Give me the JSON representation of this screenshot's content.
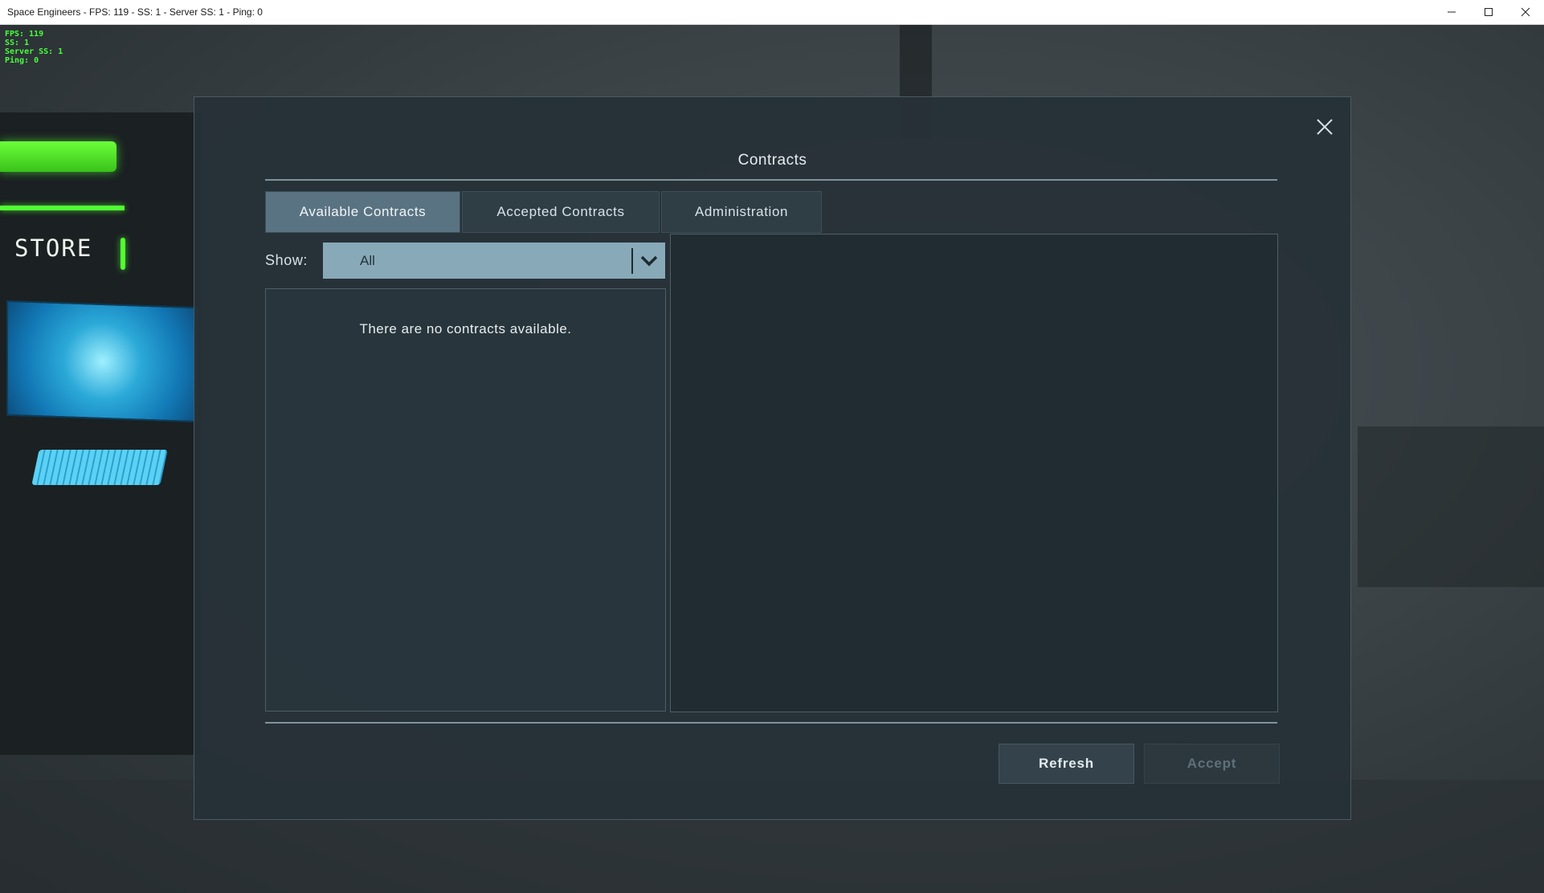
{
  "window": {
    "title": "Space Engineers - FPS: 119 - SS: 1 - Server SS: 1 - Ping: 0"
  },
  "hud": {
    "stats": [
      "FPS: 119",
      "SS: 1",
      "Server SS: 1",
      "Ping: 0"
    ]
  },
  "scene": {
    "store_sign": "STORE"
  },
  "dialog": {
    "title": "Contracts",
    "tabs": [
      {
        "label": "Available Contracts",
        "active": true
      },
      {
        "label": "Accepted Contracts",
        "active": false
      },
      {
        "label": "Administration",
        "active": false
      }
    ],
    "filter": {
      "label": "Show:",
      "selected": "All"
    },
    "list": {
      "empty_message": "There are no contracts available."
    },
    "buttons": {
      "refresh": "Refresh",
      "accept": "Accept"
    }
  },
  "icons": {
    "close": "close-icon",
    "dropdown": "chevron-down-icon",
    "minimize": "minimize-icon",
    "maximize": "maximize-icon",
    "window_close": "window-close-icon"
  },
  "colors": {
    "hud_green": "#49ff3c",
    "tab_active": "#5a7382",
    "select_bg": "#88a9b8",
    "accept_disabled_text": "#5f7078"
  }
}
